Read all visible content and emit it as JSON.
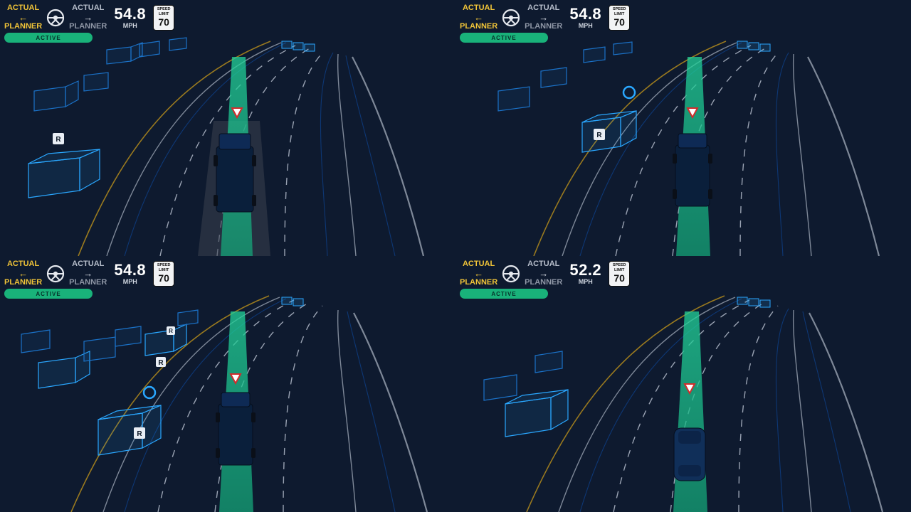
{
  "common": {
    "labels": {
      "actual": "ACTUAL",
      "planner": "PLANNER",
      "mph": "MPH",
      "speed_limit_top": "SPEED",
      "speed_limit_mid": "LIMIT"
    },
    "status": {
      "label": "ACTIVE",
      "color": "#19b27a"
    },
    "icons": {
      "steering": "steering-wheel-icon",
      "yield": "yield-icon",
      "r_chip": "R"
    },
    "colors": {
      "bg": "#0e1a2f",
      "accent_green": "#18c28d",
      "accent_yellow": "#f2c538",
      "box_blue": "#2aa7ff"
    }
  },
  "panels": [
    {
      "id": "tl",
      "speed": "54.8",
      "limit": "70",
      "ego_gray_lane": true,
      "vehicle": "truck",
      "has_ring_marker": false
    },
    {
      "id": "tr",
      "speed": "54.8",
      "limit": "70",
      "ego_gray_lane": false,
      "vehicle": "truck",
      "has_ring_marker": true
    },
    {
      "id": "bl",
      "speed": "54.8",
      "limit": "70",
      "ego_gray_lane": false,
      "vehicle": "truck",
      "has_ring_marker": true
    },
    {
      "id": "br",
      "speed": "52.2",
      "limit": "70",
      "ego_gray_lane": false,
      "vehicle": "van",
      "has_ring_marker": false
    }
  ]
}
